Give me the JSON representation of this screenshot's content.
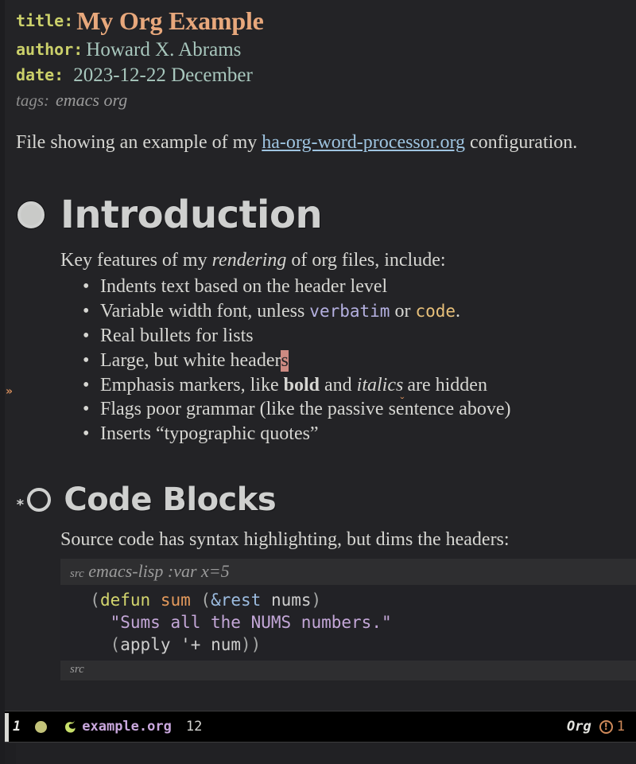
{
  "window": {
    "buffer_name": "example.org"
  },
  "keywords": {
    "title_key": "title:",
    "title_value": "My Org Example",
    "author_key": "author:",
    "author_value": "Howard X. Abrams",
    "date_key": "date:",
    "date_value": "2023-12-22 December",
    "tags_key": "tags:",
    "tags_value": "emacs org"
  },
  "intro": {
    "before_link": "File showing an example of my ",
    "link_text": "ha-org-word-processor.org",
    "after_link": " configuration."
  },
  "sections": [
    {
      "bullet": "ring-filled-icon",
      "stars": "",
      "title": "Introduction",
      "lead": {
        "part1": "Key features of my ",
        "italic": "rendering",
        "part2": " of org files, include:"
      },
      "bullets": [
        {
          "id": "indents",
          "text": "Indents text based on the header level"
        },
        {
          "id": "variable-width",
          "pre": "Variable width font, unless ",
          "verbatim": "verbatim",
          "mid": " or ",
          "code": "code",
          "post": "."
        },
        {
          "id": "real-bullets",
          "text": "Real bullets for lists"
        },
        {
          "id": "white-headers",
          "pre": "Large, but white header",
          "cursor": "s"
        },
        {
          "id": "emphasis-markers",
          "pre": "Emphasis markers, like ",
          "bold": "bold",
          "mid": " and ",
          "italic": "italics",
          "flag": "ˬ",
          "post": "are hidden"
        },
        {
          "id": "grammar-flags",
          "text": "Flags poor grammar (like the passive sentence above)"
        },
        {
          "id": "typographic-quotes",
          "text": "Inserts “typographic quotes”"
        }
      ]
    },
    {
      "bullet": "ring-open-icon",
      "stars": "*",
      "title": "Code Blocks",
      "lead": "Source code has syntax highlighting, but dims the headers:",
      "src_block": {
        "begin_keyword": "src",
        "begin_args": "emacs-lisp :var x=5",
        "end_keyword": "src",
        "lines": [
          [
            {
              "t": "(",
              "c": "paren"
            },
            {
              "t": "defun",
              "c": "keyword"
            },
            {
              "t": " ",
              "c": "plain"
            },
            {
              "t": "sum",
              "c": "func"
            },
            {
              "t": " ",
              "c": "plain"
            },
            {
              "t": "(",
              "c": "paren"
            },
            {
              "t": "&rest",
              "c": "arg"
            },
            {
              "t": " ",
              "c": "plain"
            },
            {
              "t": "nums",
              "c": "var"
            },
            {
              "t": ")",
              "c": "paren"
            }
          ],
          [
            {
              "t": "  ",
              "c": "plain"
            },
            {
              "t": "\"Sums all the NUMS numbers.\"",
              "c": "string"
            }
          ],
          [
            {
              "t": "  ",
              "c": "plain"
            },
            {
              "t": "(",
              "c": "paren"
            },
            {
              "t": "apply",
              "c": "var"
            },
            {
              "t": " ",
              "c": "plain"
            },
            {
              "t": "'+",
              "c": "var"
            },
            {
              "t": " ",
              "c": "plain"
            },
            {
              "t": "num",
              "c": "var"
            },
            {
              "t": "))",
              "c": "paren"
            }
          ]
        ],
        "indent": "  "
      }
    }
  ],
  "fringe": {
    "marker": "»"
  },
  "mode_line": {
    "window_number": "1",
    "buffer_name": "example.org",
    "line_number": "12",
    "major_mode": "Org",
    "error_icon": "!",
    "error_count": "1"
  },
  "colors": {
    "background": "#232326",
    "code_background": "#222226",
    "src_header_background": "#2e2e30",
    "title": "#e8a87c",
    "keyword": "#cbd06a",
    "metadata_value": "#a8c7bd",
    "link": "#9ec4e0",
    "heading": "#cfd0cf",
    "verbatim": "#b4b0e0",
    "code": "#e8c07a",
    "cursor": "#cd8a82",
    "fringe_marker": "#d08a5a",
    "mode_line_background": "#000000",
    "mode_line_buffer": "#c9a7dd",
    "mode_line_dot": "#c3c379",
    "mode_line_gnu": "#c8e06a",
    "error": "#d08a5a"
  }
}
